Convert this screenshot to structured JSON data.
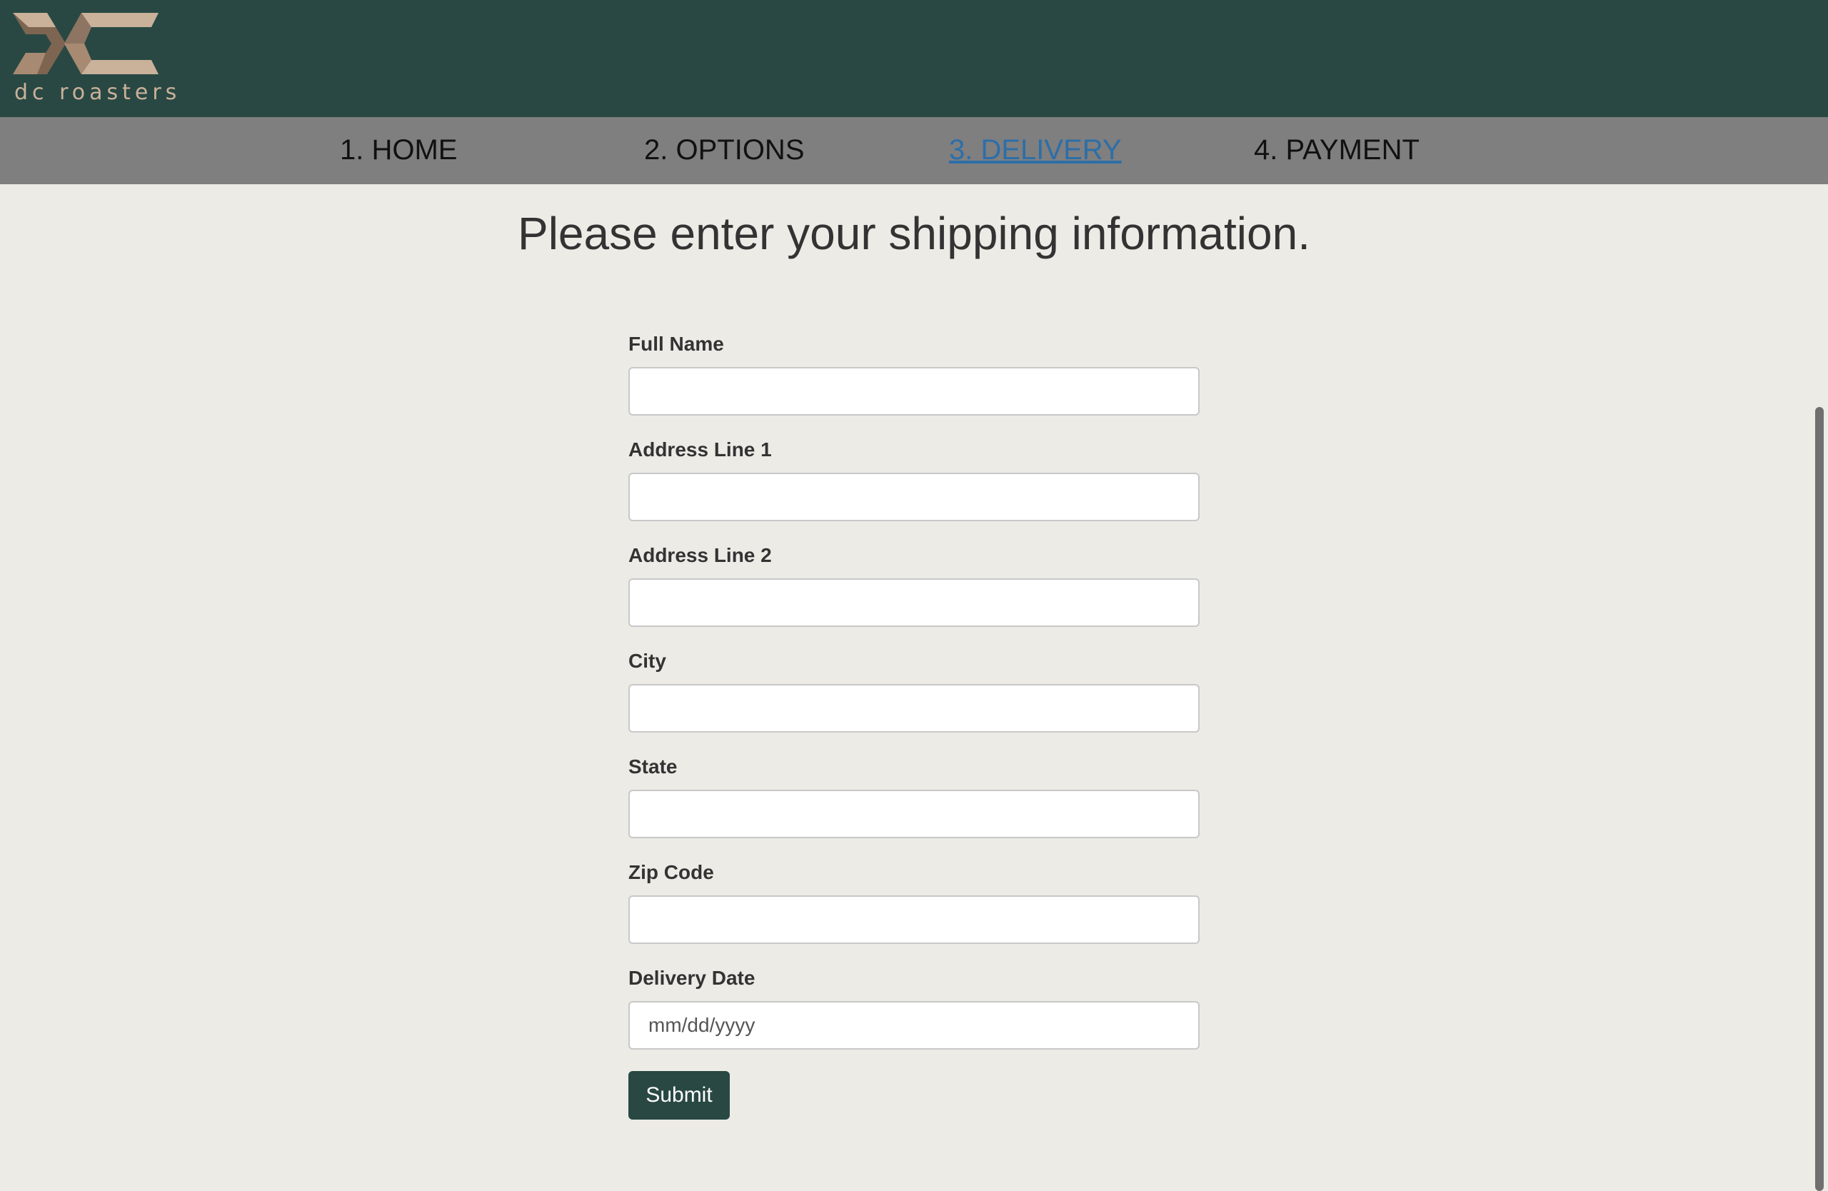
{
  "brand": {
    "name": "dc roasters",
    "logo_icon": "dc-monogram-logo",
    "colors": {
      "header_bg": "#294843",
      "logo_tan": "#c9b19a",
      "logo_brown": "#7d6552",
      "nav_bg": "#7f7f7f",
      "nav_active": "#2d6ea8",
      "page_bg": "#ecebe6"
    }
  },
  "nav": {
    "items": [
      {
        "label": "1. HOME",
        "active": false
      },
      {
        "label": "2. OPTIONS",
        "active": false
      },
      {
        "label": "3. DELIVERY",
        "active": true
      },
      {
        "label": "4. PAYMENT",
        "active": false
      }
    ]
  },
  "page": {
    "title": "Please enter your shipping information."
  },
  "form": {
    "fields": [
      {
        "label": "Full Name",
        "value": "",
        "placeholder": ""
      },
      {
        "label": "Address Line 1",
        "value": "",
        "placeholder": ""
      },
      {
        "label": "Address Line 2",
        "value": "",
        "placeholder": ""
      },
      {
        "label": "City",
        "value": "",
        "placeholder": ""
      },
      {
        "label": "State",
        "value": "",
        "placeholder": ""
      },
      {
        "label": "Zip Code",
        "value": "",
        "placeholder": ""
      },
      {
        "label": "Delivery Date",
        "value": "",
        "placeholder": "mm/dd/yyyy"
      }
    ],
    "submit_label": "Submit"
  }
}
